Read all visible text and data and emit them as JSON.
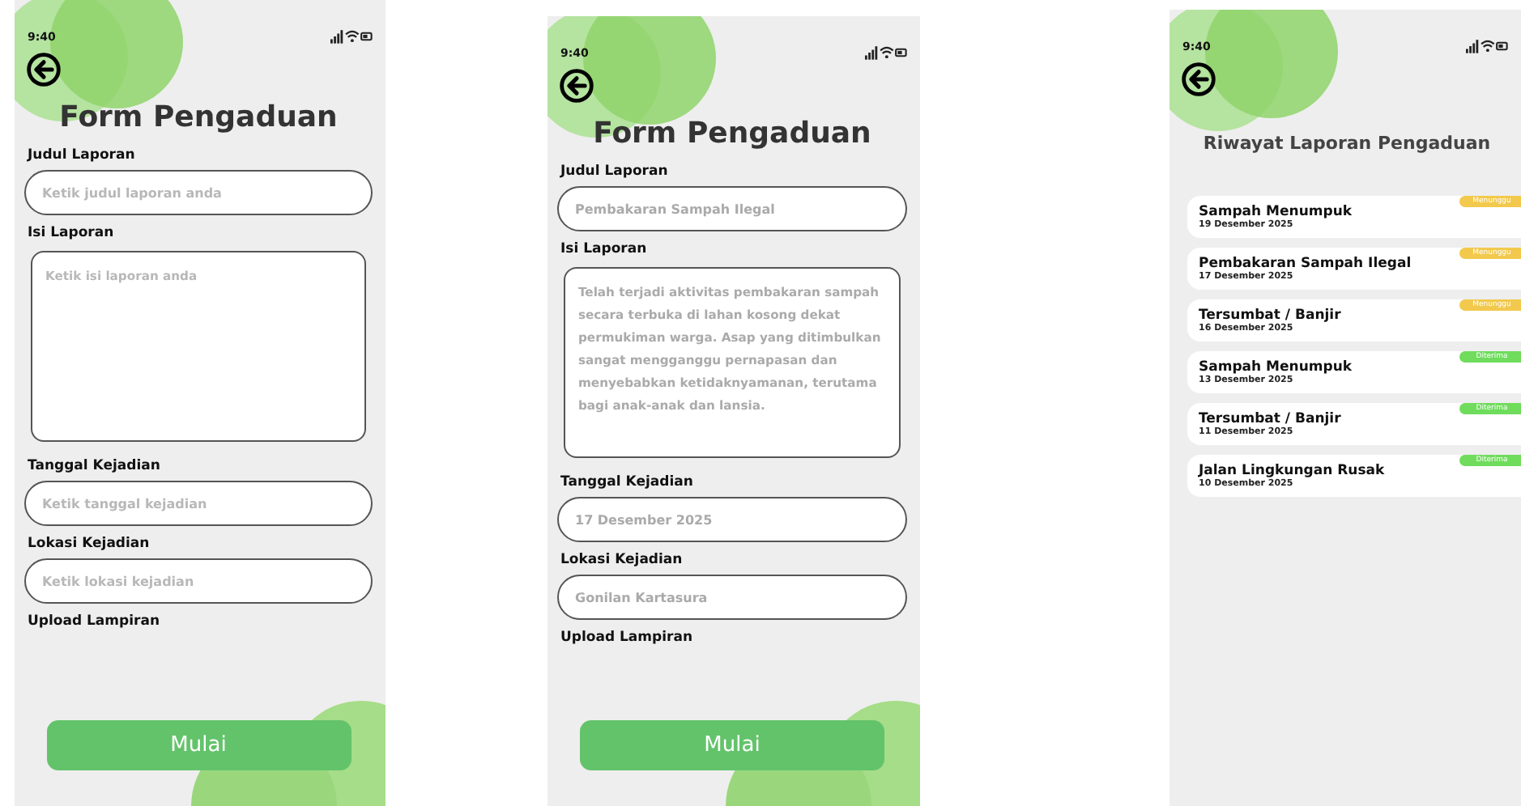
{
  "screens": [
    {
      "kind": "form",
      "time": "9:40",
      "title": "Form Pengaduan",
      "fields": [
        {
          "kind": "input",
          "label": "Judul Laporan",
          "placeholder": "Ketik judul laporan anda"
        },
        {
          "kind": "textarea",
          "label": "Isi Laporan",
          "placeholder": "Ketik isi laporan anda"
        },
        {
          "kind": "input",
          "label": "Tanggal Kejadian",
          "placeholder": "Ketik tanggal kejadian"
        },
        {
          "kind": "input",
          "label": "Lokasi Kejadian",
          "placeholder": "Ketik lokasi kejadian"
        },
        {
          "kind": "upload",
          "label": "Upload Lampiran"
        }
      ],
      "button": "Mulai"
    },
    {
      "kind": "form",
      "time": "9:40",
      "title": "Form Pengaduan",
      "fields": [
        {
          "kind": "input",
          "label": "Judul Laporan",
          "value": "Pembakaran Sampah Ilegal"
        },
        {
          "kind": "textarea",
          "label": "Isi Laporan",
          "value": "Telah terjadi aktivitas pembakaran sampah secara terbuka di lahan kosong dekat permukiman warga. Asap yang ditimbulkan sangat mengganggu pernapasan dan menyebabkan ketidaknyamanan, terutama bagi anak-anak dan lansia."
        },
        {
          "kind": "input",
          "label": "Tanggal Kejadian",
          "value": "17 Desember 2025"
        },
        {
          "kind": "input",
          "label": "Lokasi Kejadian",
          "value": "Gonilan Kartasura"
        },
        {
          "kind": "upload",
          "label": "Upload Lampiran"
        }
      ],
      "button": "Mulai"
    },
    {
      "kind": "history",
      "time": "9:40",
      "title": "Riwayat Laporan Pengaduan",
      "reports": [
        {
          "title": "Sampah Menumpuk",
          "date": "19 Desember 2025",
          "status": "Menunggu",
          "color": "#f2c94c"
        },
        {
          "title": "Pembakaran Sampah Ilegal",
          "date": "17 Desember 2025",
          "status": "Menunggu",
          "color": "#f2c94c"
        },
        {
          "title": "Tersumbat / Banjir",
          "date": "16 Desember 2025",
          "status": "Menunggu",
          "color": "#f2c94c"
        },
        {
          "title": "Sampah Menumpuk",
          "date": "13 Desember 2025",
          "status": "Diterima",
          "color": "#6fdc5c"
        },
        {
          "title": "Tersumbat / Banjir",
          "date": "11 Desember 2025",
          "status": "Diterima",
          "color": "#6fdc5c"
        },
        {
          "title": "Jalan Lingkungan Rusak",
          "date": "10 Desember 2025",
          "status": "Diterima",
          "color": "#6fdc5c"
        }
      ]
    }
  ]
}
